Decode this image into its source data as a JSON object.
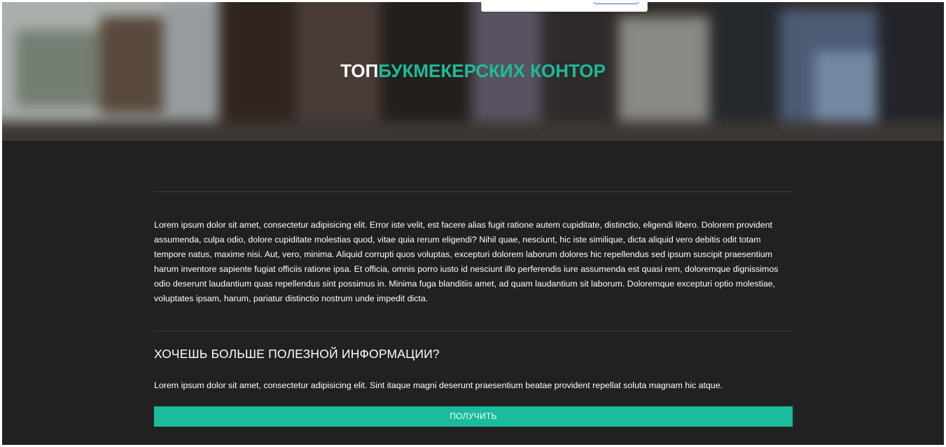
{
  "hero": {
    "title_part1": "ТОП",
    "title_part2": "БУКМЕКЕРСКИХ КОНТОР"
  },
  "main": {
    "paragraph": "Lorem ipsum dolor sit amet, consectetur adipisicing elit. Error iste velit, est facere alias fugit ratione autem cupiditate, distinctio, eligendi libero. Dolorem provident assumenda, culpa odio, dolore cupiditate molestias quod, vitae quia rerum eligendi? Nihil quae, nesciunt, hic iste similique, dicta aliquid vero debitis odit totam tempore natus, maxime nisi. Aut, vero, minima. Aliquid corrupti quos voluptas, excepturi dolorem laborum dolores hic repellendus sed ipsum suscipit praesentium harum inventore sapiente fugiat officiis ratione ipsa. Et officia, omnis porro iusto id nesciunt illo perferendis iure assumenda est quasi rem, doloremque dignissimos odio deserunt laudantium quas repellendus sint possimus in. Minima fuga blanditiis amet, ad quam laudantium sit laborum. Doloremque excepturi optio molestiae, voluptates ipsam, harum, pariatur distinctio nostrum unde impedit dicta."
  },
  "cta": {
    "title": "ХОЧЕШЬ БОЛЬШЕ ПОЛЕЗНОЙ ИНФОРМАЦИИ?",
    "text": "Lorem ipsum dolor sit amet, consectetur adipisicing elit. Sint itaque magni deserunt praesentium beatae provident repellat soluta magnam hic atque.",
    "button_label": "ПОЛУЧИТЬ"
  },
  "colors": {
    "accent": "#1abc9c",
    "background": "#212121",
    "text": "#ffffff"
  }
}
